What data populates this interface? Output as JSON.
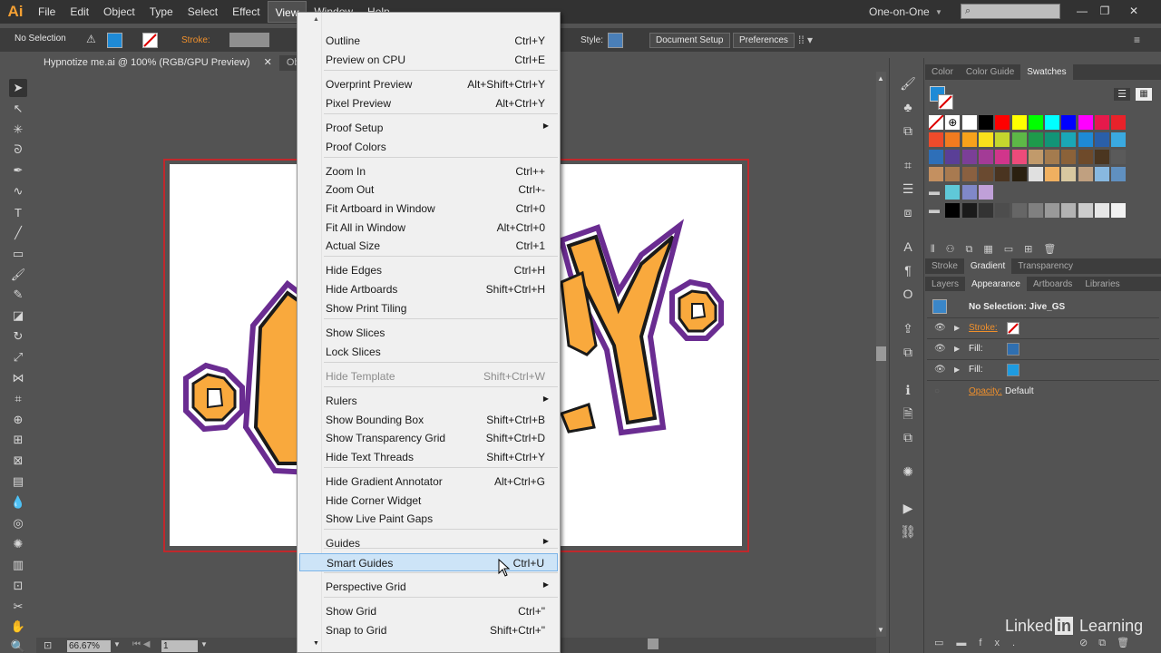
{
  "app": {
    "logo": "Ai"
  },
  "menubar": {
    "items": [
      "File",
      "Edit",
      "Object",
      "Type",
      "Select",
      "Effect",
      "View",
      "Window",
      "Help"
    ],
    "active": "View",
    "workspace": "One-on-One"
  },
  "control": {
    "selection": "No Selection",
    "stroke_label": "Stroke:",
    "style_label": "Style:",
    "document_setup": "Document Setup",
    "preferences": "Preferences"
  },
  "tabs": [
    {
      "label": "Hypnotize me.ai @ 100% (RGB/GPU Preview)",
      "active": true
    },
    {
      "label": "Obe",
      "active": false
    }
  ],
  "status": {
    "zoom": "66.67%",
    "page": "1"
  },
  "view_menu": {
    "items": [
      {
        "label": "Outline",
        "shortcut": "Ctrl+Y"
      },
      {
        "label": "Preview on CPU",
        "shortcut": "Ctrl+E"
      },
      {
        "label": "Overprint Preview",
        "shortcut": "Alt+Shift+Ctrl+Y"
      },
      {
        "label": "Pixel Preview",
        "shortcut": "Alt+Ctrl+Y"
      },
      {
        "label": "Proof Setup",
        "shortcut": ""
      },
      {
        "label": "Proof Colors",
        "shortcut": ""
      },
      {
        "label": "Zoom In",
        "shortcut": "Ctrl++"
      },
      {
        "label": "Zoom Out",
        "shortcut": "Ctrl+-"
      },
      {
        "label": "Fit Artboard in Window",
        "shortcut": "Ctrl+0"
      },
      {
        "label": "Fit All in Window",
        "shortcut": "Alt+Ctrl+0"
      },
      {
        "label": "Actual Size",
        "shortcut": "Ctrl+1"
      },
      {
        "label": "Hide Edges",
        "shortcut": "Ctrl+H"
      },
      {
        "label": "Hide Artboards",
        "shortcut": "Shift+Ctrl+H"
      },
      {
        "label": "Show Print Tiling",
        "shortcut": ""
      },
      {
        "label": "Show Slices",
        "shortcut": ""
      },
      {
        "label": "Lock Slices",
        "shortcut": ""
      },
      {
        "label": "Hide Template",
        "shortcut": "Shift+Ctrl+W"
      },
      {
        "label": "Rulers",
        "shortcut": ""
      },
      {
        "label": "Show Bounding Box",
        "shortcut": "Shift+Ctrl+B"
      },
      {
        "label": "Show Transparency Grid",
        "shortcut": "Shift+Ctrl+D"
      },
      {
        "label": "Hide Text Threads",
        "shortcut": "Shift+Ctrl+Y"
      },
      {
        "label": "Hide Gradient Annotator",
        "shortcut": "Alt+Ctrl+G"
      },
      {
        "label": "Hide Corner Widget",
        "shortcut": ""
      },
      {
        "label": "Show Live Paint Gaps",
        "shortcut": ""
      },
      {
        "label": "Guides",
        "shortcut": ""
      },
      {
        "label": "Smart Guides",
        "shortcut": "Ctrl+U"
      },
      {
        "label": "Perspective Grid",
        "shortcut": ""
      },
      {
        "label": "Show Grid",
        "shortcut": "Ctrl+\""
      },
      {
        "label": "Snap to Grid",
        "shortcut": "Shift+Ctrl+\""
      }
    ]
  },
  "panels": {
    "swatch_tabs": [
      "Color",
      "Color Guide",
      "Swatches"
    ],
    "mid_tabs": [
      "Stroke",
      "Gradient",
      "Transparency"
    ],
    "lower_tabs": [
      "Layers",
      "Appearance",
      "Artboards",
      "Libraries"
    ],
    "appearance": {
      "title": "No Selection: Jive_GS",
      "rows": [
        "Stroke:",
        "Fill:",
        "Fill:"
      ],
      "opacity_label": "Opacity:",
      "opacity_value": "Default"
    }
  },
  "colors": {
    "accent": "#f0902c",
    "art_orange": "#f9a93d",
    "art_purple": "#6a2c91",
    "menu_highlight": "#cde4f7"
  },
  "watermark": {
    "pre": "Linked",
    "mid": "in",
    "post": " Learning"
  }
}
